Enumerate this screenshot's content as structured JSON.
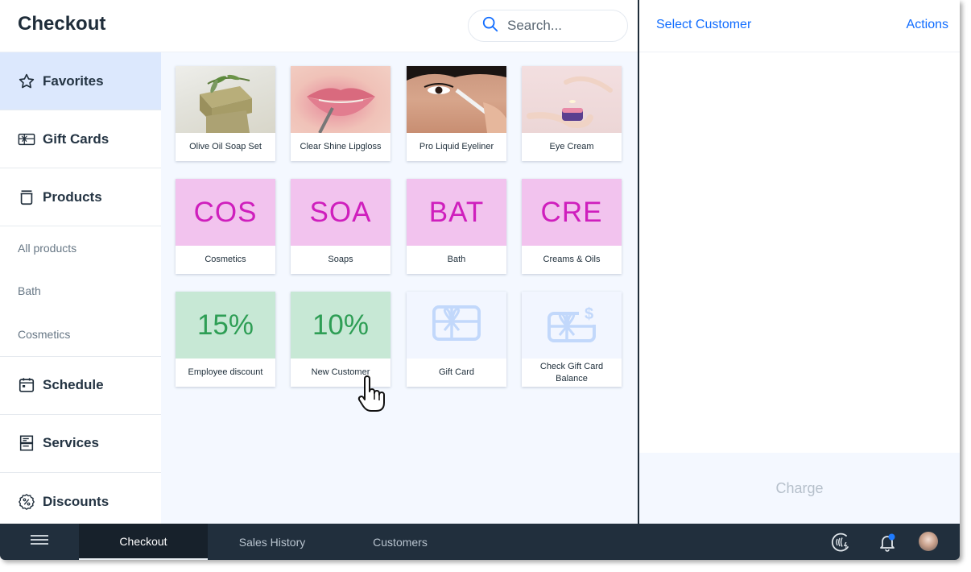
{
  "header": {
    "title": "Checkout",
    "search_placeholder": "Search..."
  },
  "sidebar": {
    "items": [
      {
        "label": "Favorites",
        "icon": "star-icon",
        "active": true
      },
      {
        "label": "Gift Cards",
        "icon": "gift-card-icon"
      },
      {
        "label": "Products",
        "icon": "jar-icon"
      }
    ],
    "product_subitems": [
      "All products",
      "Bath",
      "Cosmetics"
    ],
    "items_after": [
      {
        "label": "Schedule",
        "icon": "calendar-icon"
      },
      {
        "label": "Services",
        "icon": "services-icon"
      },
      {
        "label": "Discounts",
        "icon": "discount-badge-icon"
      }
    ]
  },
  "tiles": [
    {
      "label": "Olive Oil Soap Set",
      "type": "photo",
      "image": "olive-oil-soap-photo"
    },
    {
      "label": "Clear Shine Lipgloss",
      "type": "photo",
      "image": "lipgloss-photo"
    },
    {
      "label": "Pro Liquid Eyeliner",
      "type": "photo",
      "image": "eyeliner-photo"
    },
    {
      "label": "Eye Cream",
      "type": "photo",
      "image": "eye-cream-photo"
    },
    {
      "label": "Cosmetics",
      "type": "category",
      "code": "COS"
    },
    {
      "label": "Soaps",
      "type": "category",
      "code": "SOA"
    },
    {
      "label": "Bath",
      "type": "category",
      "code": "BAT"
    },
    {
      "label": "Creams & Oils",
      "type": "category",
      "code": "CRE"
    },
    {
      "label": "Employee discount",
      "type": "discount",
      "value": "15%"
    },
    {
      "label": "New Customer",
      "type": "discount",
      "value": "10%"
    },
    {
      "label": "Gift Card",
      "type": "giftcard",
      "icon": "gift-card-icon"
    },
    {
      "label": "Check Gift Card Balance",
      "type": "giftcard-balance",
      "icon": "gift-card-balance-icon"
    }
  ],
  "right_panel": {
    "select_customer": "Select Customer",
    "actions": "Actions",
    "charge": "Charge"
  },
  "bottom_bar": {
    "tabs": [
      {
        "label": "Checkout",
        "active": true
      },
      {
        "label": "Sales History"
      },
      {
        "label": "Customers"
      }
    ],
    "icons": [
      "menu-icon",
      "contactless-payment-icon",
      "notification-bell-icon",
      "user-avatar"
    ],
    "notification_dot": true
  },
  "colors": {
    "accent": "#116dff",
    "category_tile_bg": "#f2c3ee",
    "category_code": "#cf1fbd",
    "discount_tile_bg": "#c7e8d5",
    "discount_value": "#2e9e55",
    "sidebar_active_bg": "#dce8fd",
    "bottom_bar_bg": "#212f3d"
  }
}
